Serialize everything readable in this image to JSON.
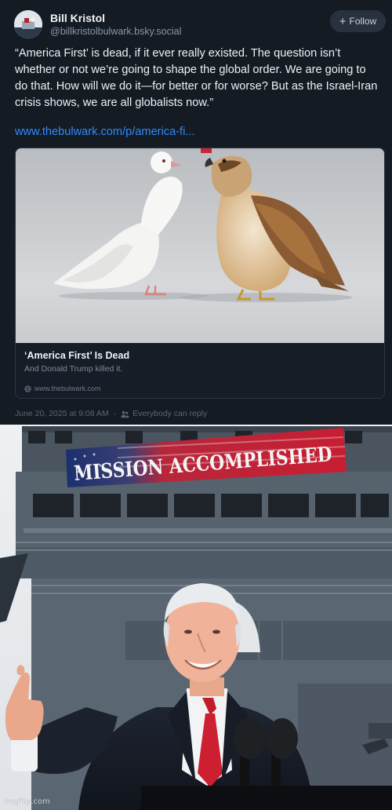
{
  "post": {
    "author_name": "Bill Kristol",
    "author_handle": "@billkristolbulwark.bsky.social",
    "follow_label": "Follow",
    "body_text": "“America First’ is dead, if it ever really existed. The question isn’t whether or not we’re going to shape the global order. We are going to do that. How will we do it—for better or for worse? But as the Israel-Iran crisis shows, we are all globalists now.”",
    "link_text": "www.thebulwark.com/p/america-fi...",
    "card": {
      "title": "‘America First’ Is Dead",
      "description": "And Donald Trump killed it.",
      "domain": "www.thebulwark.com"
    },
    "timestamp": "June 20, 2025 at 9:08 AM",
    "reply_setting": "Everybody can reply"
  },
  "meme": {
    "banner_text": "MISSION ACCOMPLISHED",
    "watermark": "imgflip.com"
  },
  "icons": {
    "follow": "plus-icon",
    "domain": "globe-icon",
    "reply_setting": "people-icon"
  },
  "colors": {
    "post_background": "#141b23",
    "link": "#2e8bff",
    "banner_red": "#c81e32",
    "banner_blue": "#1c2f6e",
    "ship_gray": "#4e5a66"
  }
}
